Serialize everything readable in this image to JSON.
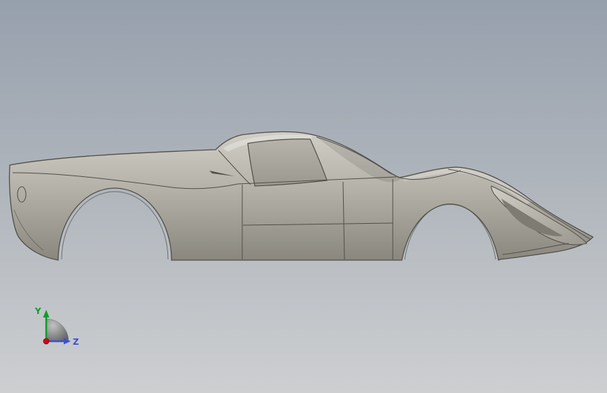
{
  "viewport": {
    "background_top_color": "#96a0ad",
    "background_bottom_color": "#cdcfd1"
  },
  "model": {
    "description": "car-body-shell-side-view",
    "body_light": "#d0cec5",
    "body_mid": "#b4b1a8",
    "body_dark": "#8a877e",
    "edge_color": "#504e48",
    "window_light": "#b6b4aa",
    "window_dark": "#9b998f",
    "tail_panel_color": "#9a978e",
    "tail_recess_color": "#7e7b73"
  },
  "triad": {
    "y_label": "Y",
    "y_color": "#0f9d2a",
    "z_label": "Z",
    "z_color": "#3a50d9",
    "x_color": "#d0021b",
    "fan_light": "#c2c2c2",
    "fan_dark": "#5c5c5c"
  }
}
